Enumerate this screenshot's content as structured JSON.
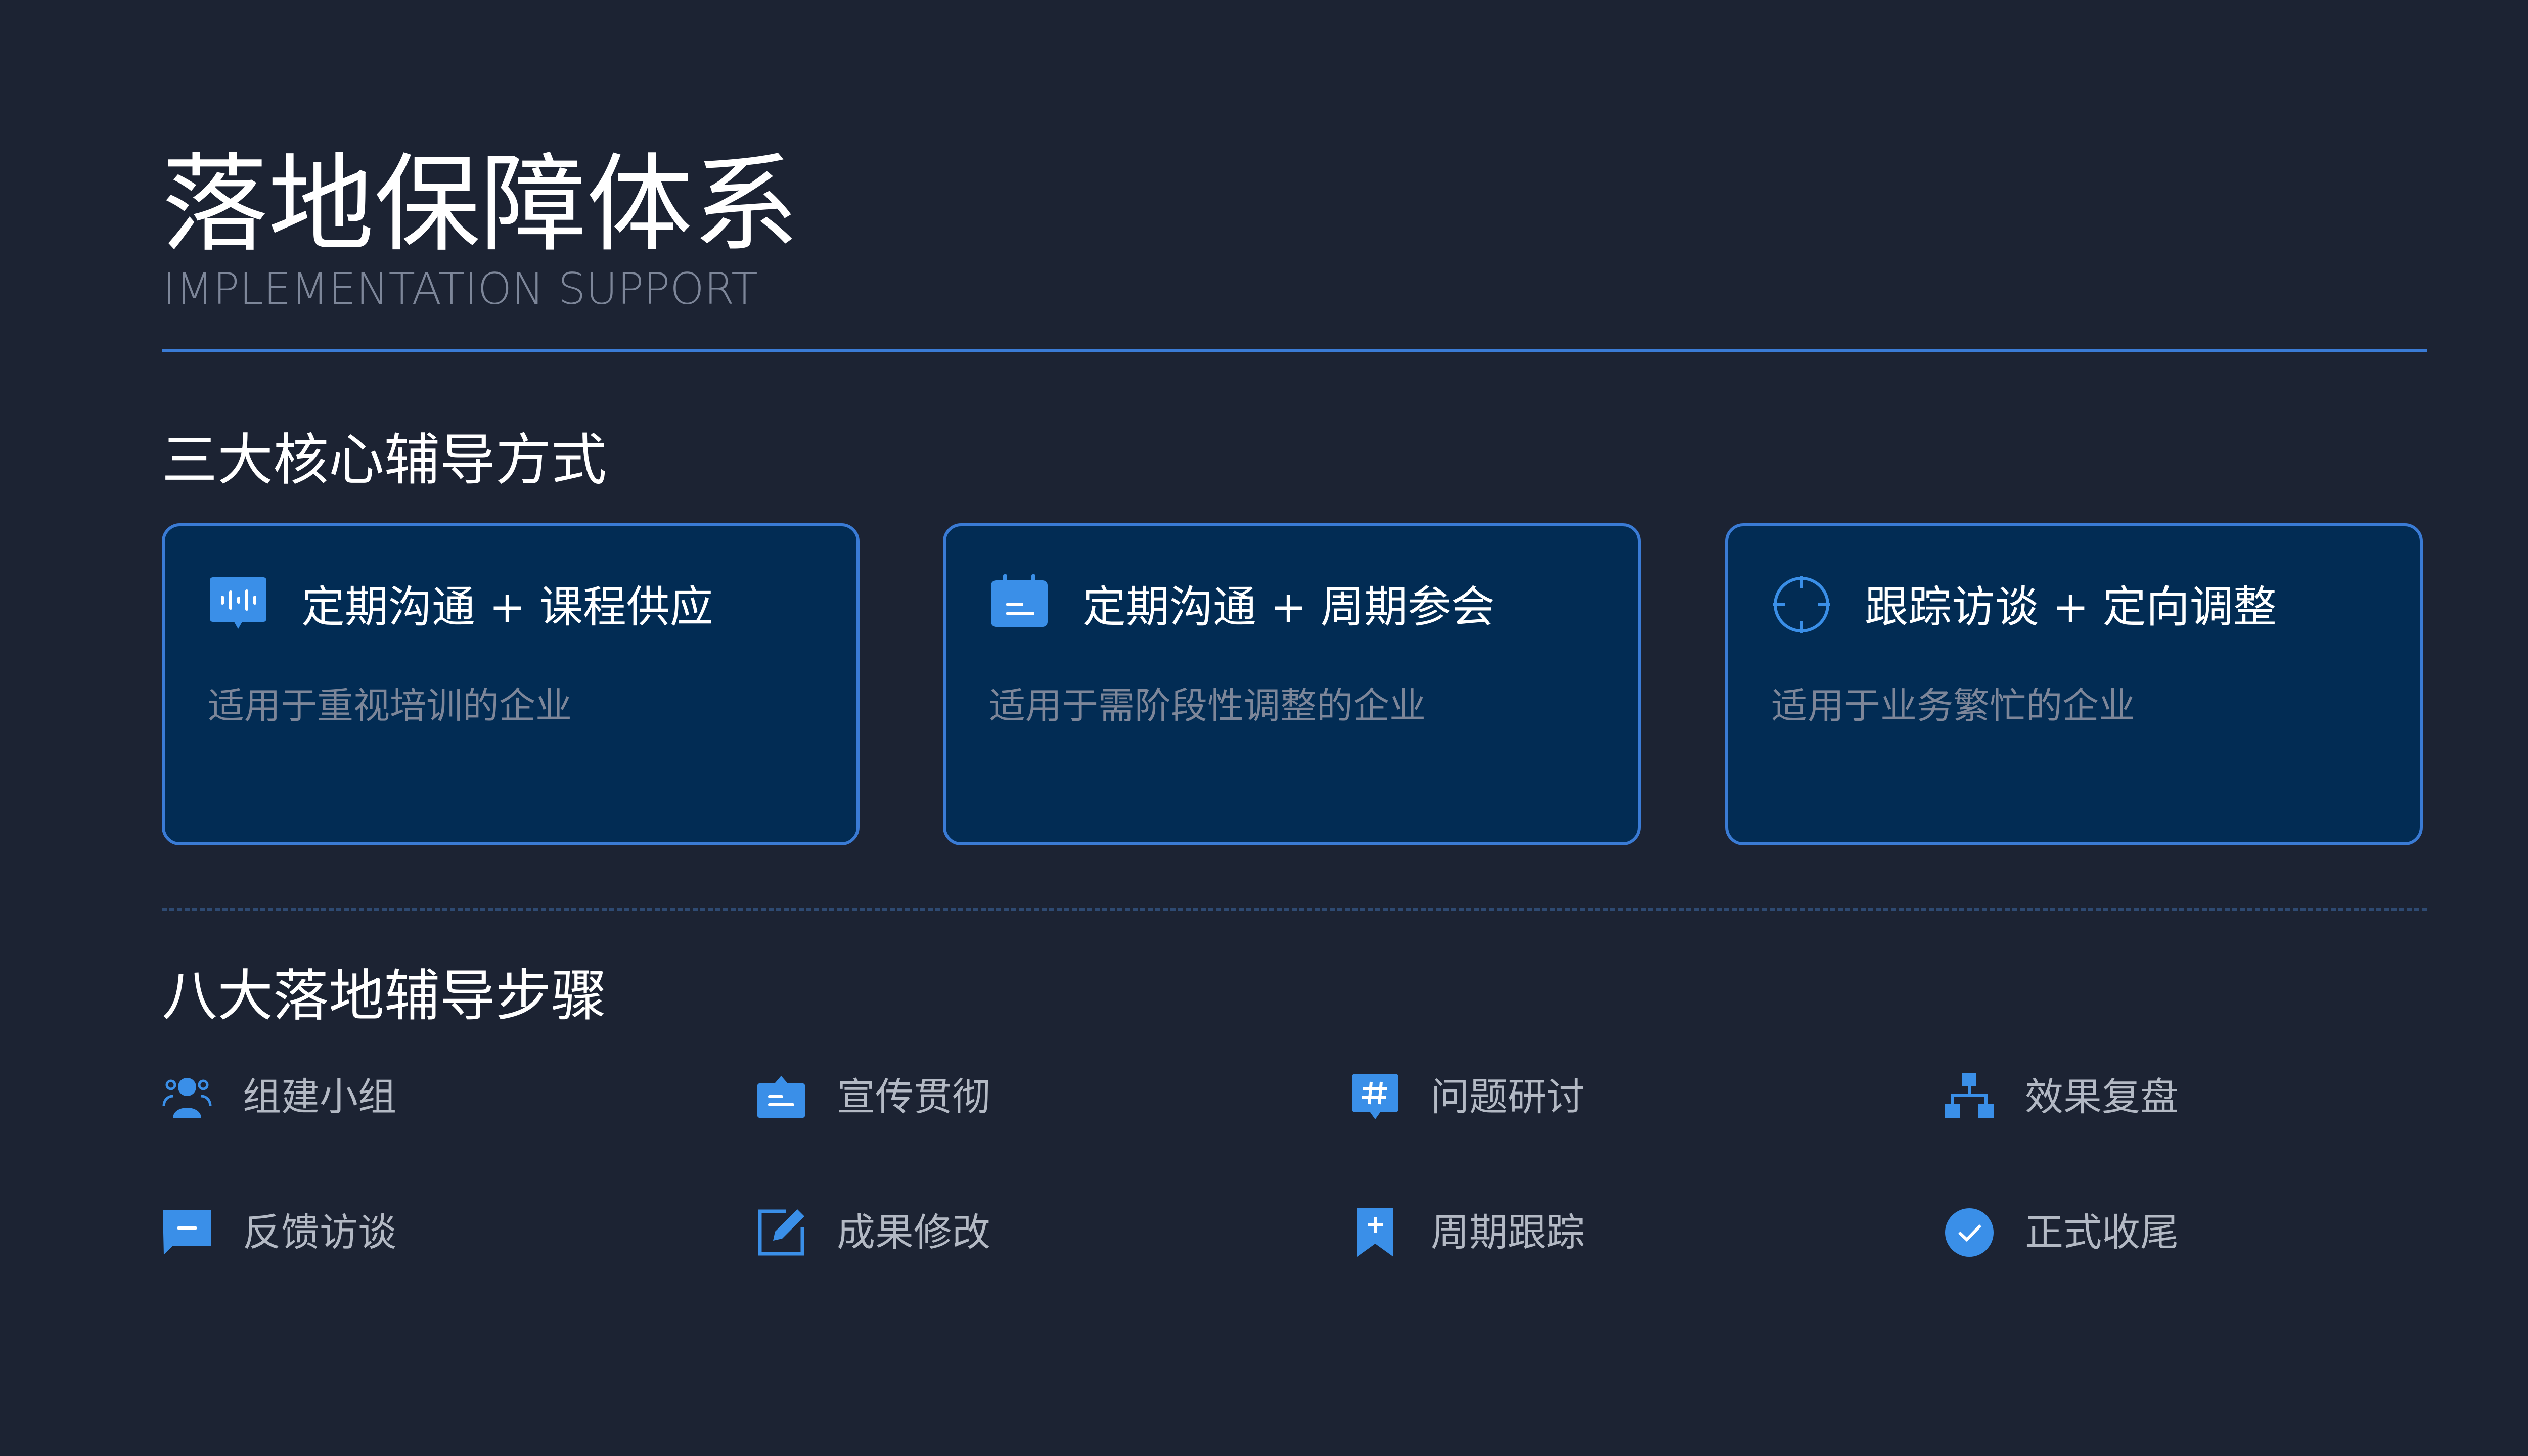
{
  "header": {
    "title": "落地保障体系",
    "subtitle": "IMPLEMENTATION SUPPORT"
  },
  "colors": {
    "background": "#1c2333",
    "accent": "#3a7bd5",
    "card_fill": "#022c54",
    "muted_text": "#7d8699"
  },
  "section_modes": {
    "title": "三大核心辅导方式",
    "cards": [
      {
        "icon": "voice-message-icon",
        "title": "定期沟通 + 课程供应",
        "description": "适用于重视培训的企业"
      },
      {
        "icon": "calendar-icon",
        "title": "定期沟通 + 周期参会",
        "description": "适用于需阶段性调整的企业"
      },
      {
        "icon": "crosshair-icon",
        "title": "跟踪访谈 + 定向调整",
        "description": "适用于业务繁忙的企业"
      }
    ]
  },
  "section_steps": {
    "title": "八大落地辅导步骤",
    "steps": [
      {
        "icon": "team-icon",
        "label": "组建小组"
      },
      {
        "icon": "announcement-icon",
        "label": "宣传贯彻"
      },
      {
        "icon": "hashtag-chat-icon",
        "label": "问题研讨"
      },
      {
        "icon": "hierarchy-icon",
        "label": "效果复盘"
      },
      {
        "icon": "chat-bubble-icon",
        "label": "反馈访谈"
      },
      {
        "icon": "edit-icon",
        "label": "成果修改"
      },
      {
        "icon": "bookmark-add-icon",
        "label": "周期跟踪"
      },
      {
        "icon": "check-circle-icon",
        "label": "正式收尾"
      }
    ]
  }
}
